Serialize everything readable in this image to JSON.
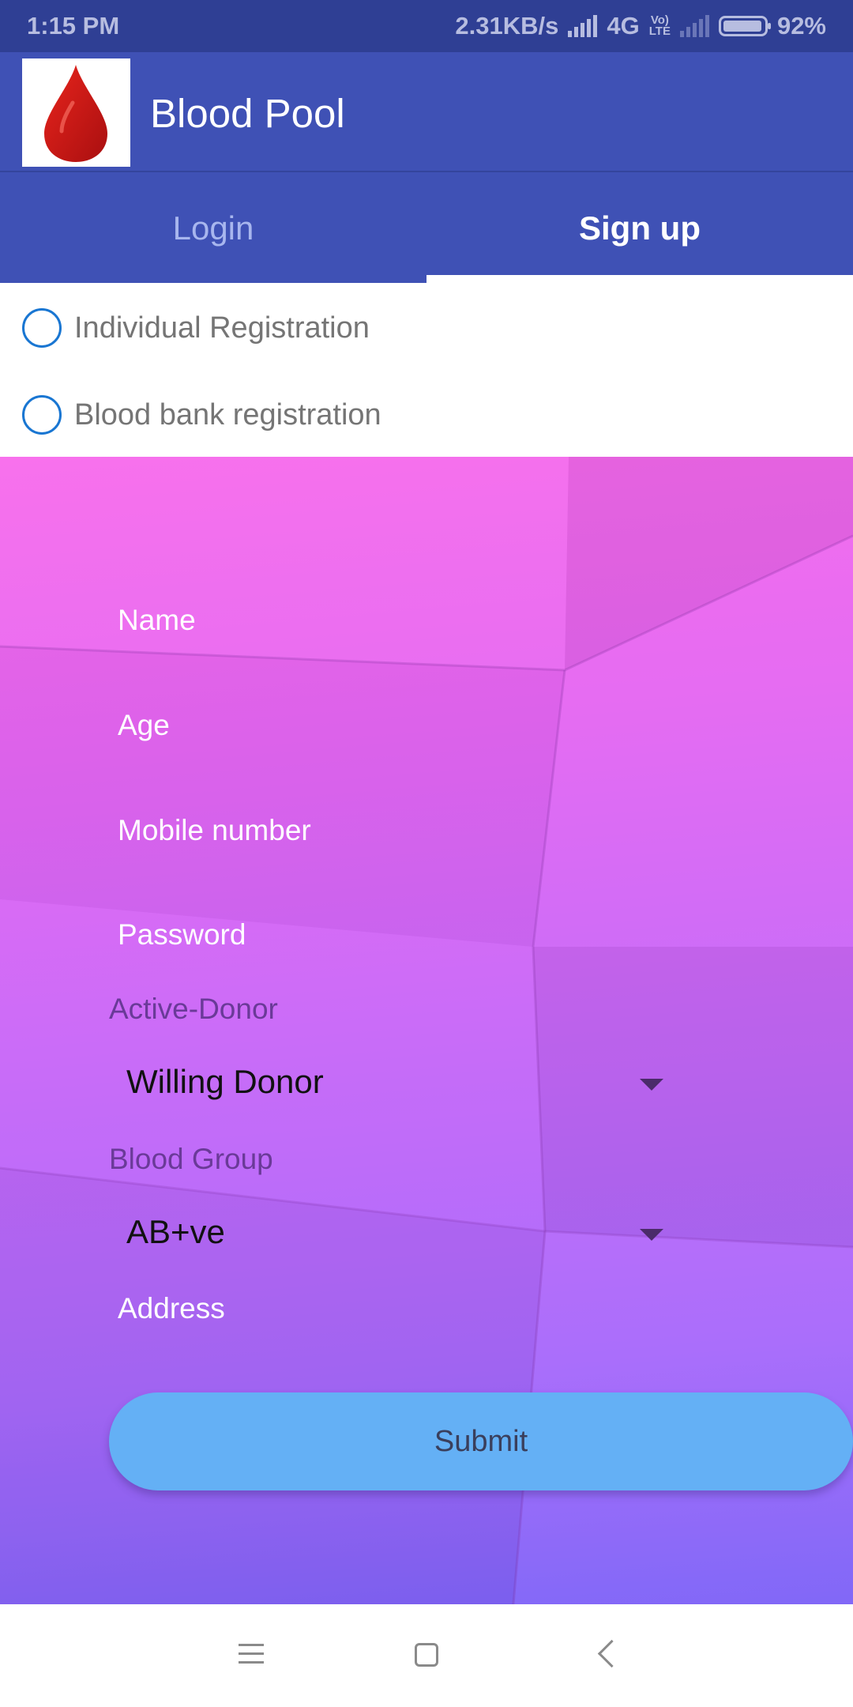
{
  "status_bar": {
    "time": "1:15 PM",
    "net_speed": "2.31KB/s",
    "network": "4G",
    "volte": [
      "Vo)",
      "LTE"
    ],
    "battery": "92%"
  },
  "app_bar": {
    "title": "Blood Pool",
    "logo_icon": "blood-drop-icon"
  },
  "tabs": [
    {
      "label": "Login",
      "selected": false
    },
    {
      "label": "Sign up",
      "selected": true
    }
  ],
  "registration_type": {
    "options": [
      "Individual Registration",
      "Blood bank registration"
    ]
  },
  "form": {
    "name_hint": "Name",
    "age_hint": "Age",
    "mobile_hint": "Mobile number",
    "password_hint": "Password",
    "active_donor_label": "Active-Donor",
    "active_donor_value": "Willing Donor",
    "blood_group_label": "Blood Group",
    "blood_group_value": "AB+ve",
    "address_hint": "Address",
    "submit_label": "Submit"
  },
  "nav_bar": {
    "icons": [
      "menu-icon",
      "home-square-icon",
      "back-chevron-icon"
    ]
  },
  "colors": {
    "primary": "#3f51b5",
    "status_bar": "#2f3f94",
    "radio_accent": "#1976d2",
    "submit_button": "#64b0f5",
    "gradient_top": "#f86aec",
    "gradient_bottom": "#7c62f7"
  }
}
